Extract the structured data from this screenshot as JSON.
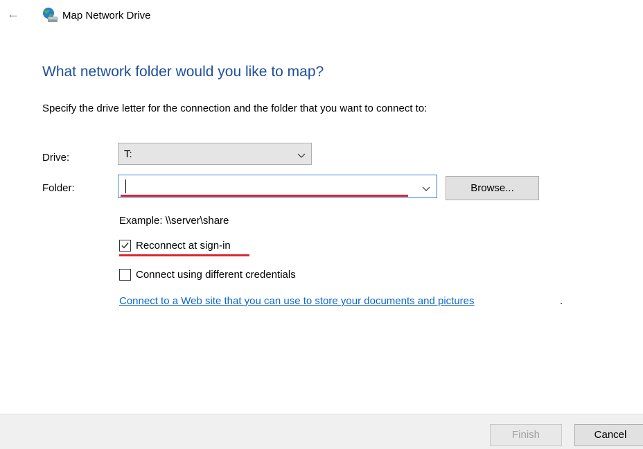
{
  "window": {
    "title": "Map Network Drive",
    "back_icon": "back-arrow-icon",
    "app_icon": "network-drive-icon"
  },
  "main": {
    "heading": "What network folder would you like to map?",
    "instruction": "Specify the drive letter for the connection and the folder that you want to connect to:"
  },
  "drive": {
    "label": "Drive:",
    "selected": "T:"
  },
  "folder": {
    "label": "Folder:",
    "value": "",
    "browse_label": "Browse...",
    "example": "Example: \\\\server\\share"
  },
  "options": {
    "reconnect": {
      "label": "Reconnect at sign-in",
      "checked": true
    },
    "credentials": {
      "label": "Connect using different credentials",
      "checked": false
    }
  },
  "link": {
    "text": "Connect to a Web site that you can use to store your documents and pictures",
    "trailing": "."
  },
  "footer": {
    "finish_label": "Finish",
    "cancel_label": "Cancel"
  },
  "colors": {
    "heading": "#1e4e9c",
    "link": "#0a67c4",
    "annotation": "#e0242f",
    "focus_border": "#3c7fd4"
  }
}
